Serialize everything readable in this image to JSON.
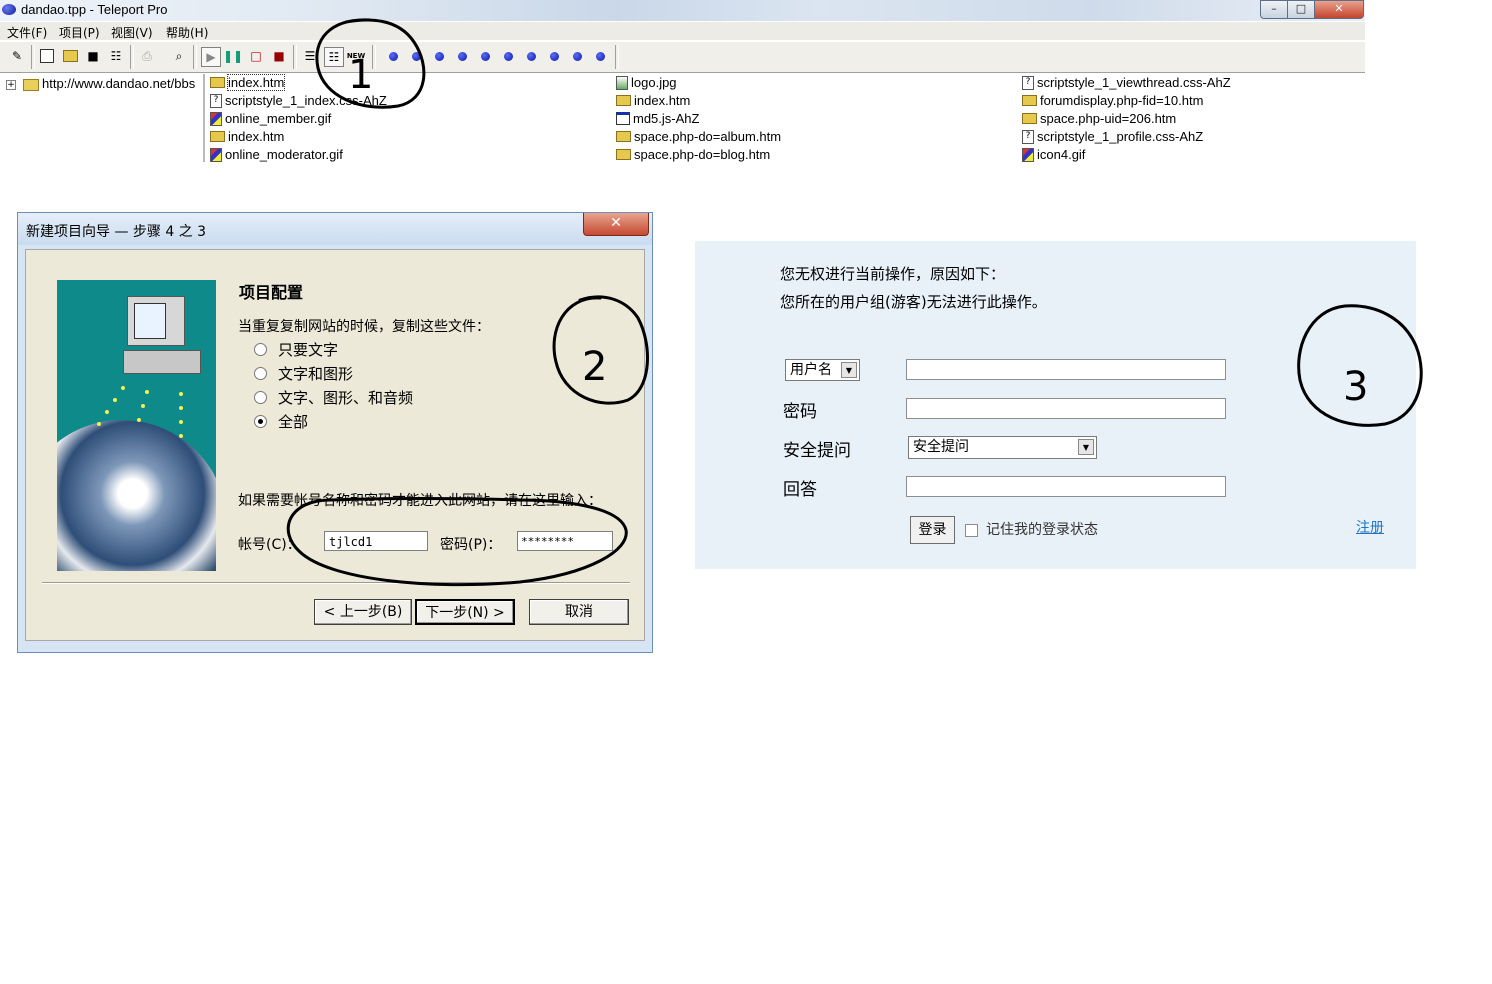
{
  "teleport": {
    "title": "dandao.tpp - Teleport Pro",
    "menu": [
      "文件(F)",
      "项目(P)",
      "视图(V)",
      "帮助(H)"
    ],
    "toolbar_new_label": "NEW",
    "tree_root": "http://www.dandao.net/bbs",
    "files": [
      {
        "name": "index.htm",
        "icon": "folder-icon",
        "selected": true
      },
      {
        "name": "scriptstyle_1_index.css-AhZ",
        "icon": "unknown-file-icon"
      },
      {
        "name": "online_member.gif",
        "icon": "image-file-icon"
      },
      {
        "name": "index.htm",
        "icon": "folder-icon"
      },
      {
        "name": "online_moderator.gif",
        "icon": "image-file-icon"
      },
      {
        "name": "logo.jpg",
        "icon": "jpg-file-icon"
      },
      {
        "name": "index.htm",
        "icon": "folder-icon"
      },
      {
        "name": "md5.js-AhZ",
        "icon": "script-file-icon"
      },
      {
        "name": "space.php-do=album.htm",
        "icon": "folder-icon"
      },
      {
        "name": "space.php-do=blog.htm",
        "icon": "folder-icon"
      },
      {
        "name": "scriptstyle_1_viewthread.css-AhZ",
        "icon": "unknown-file-icon"
      },
      {
        "name": "forumdisplay.php-fid=10.htm",
        "icon": "folder-icon"
      },
      {
        "name": "space.php-uid=206.htm",
        "icon": "folder-icon"
      },
      {
        "name": "scriptstyle_1_profile.css-AhZ",
        "icon": "unknown-file-icon"
      },
      {
        "name": "icon4.gif",
        "icon": "image-file-icon"
      }
    ]
  },
  "wizard": {
    "title": "新建项目向导 — 步骤 4 之 3",
    "heading": "项目配置",
    "question": "当重复复制网站的时候，复制这些文件：",
    "options": [
      "只要文字",
      "文字和图形",
      "文字、图形、和音频",
      "全部"
    ],
    "selected_option": 3,
    "note": "如果需要帐号名称和密码才能进入此网站，请在这里输入：",
    "account_label": "帐号(C)：",
    "account_value": "tjlcd1",
    "password_label": "密码(P)：",
    "password_value": "********",
    "buttons": {
      "back": "< 上一步(B)",
      "next": "下一步(N) >",
      "cancel": "取消"
    }
  },
  "login": {
    "message_line1": "您无权进行当前操作，原因如下：",
    "message_line2": "您所在的用户组(游客)无法进行此操作。",
    "username_select": "用户名",
    "password_label": "密码",
    "security_label": "安全提问",
    "security_select": "安全提问",
    "answer_label": "回答",
    "login_button": "登录",
    "remember_label": "记住我的登录状态",
    "register_link": "注册"
  },
  "annotations": {
    "labels": [
      "1",
      "2",
      "3"
    ]
  }
}
